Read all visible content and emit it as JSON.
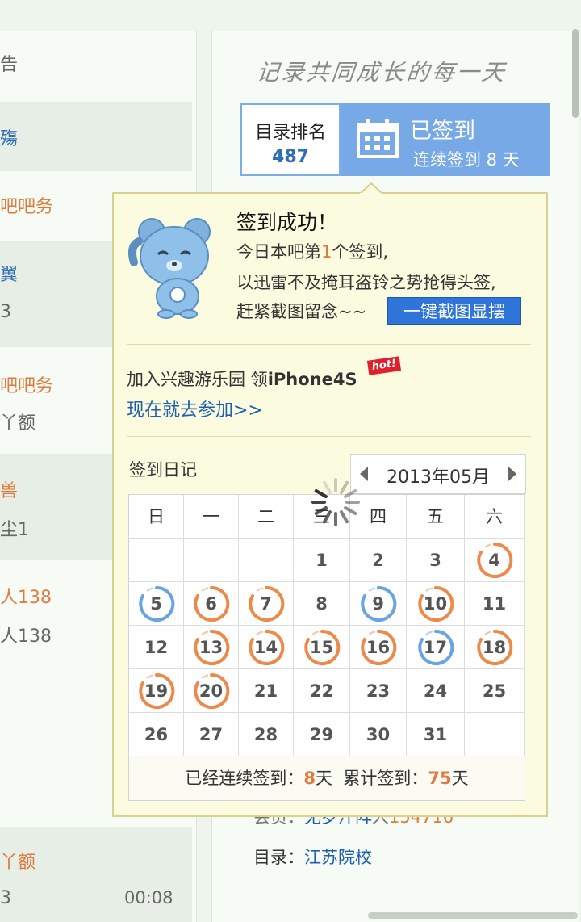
{
  "left_list": {
    "items": [
      {
        "text": "告",
        "color": "gray"
      },
      {
        "text": "殤",
        "color": "blue"
      },
      {
        "text": "吧吧务",
        "color": "orange"
      },
      {
        "text": "翼",
        "color": "blue"
      },
      {
        "text": "3",
        "color": "gray"
      },
      {
        "text": "吧吧务",
        "color": "orange"
      },
      {
        "text": "丫额",
        "color": "gray"
      },
      {
        "text": "兽",
        "color": "orange"
      },
      {
        "text": "尘1",
        "color": "gray"
      },
      {
        "text": "人138",
        "color": "orange"
      },
      {
        "text": "人138",
        "color": "gray"
      },
      {
        "text": "丫额",
        "color": "orange"
      },
      {
        "text": "3",
        "color": "gray"
      }
    ],
    "time": "00:08"
  },
  "header": {
    "slogan": "记录共同成长的每一天",
    "rank_label": "目录排名",
    "rank_value": "487",
    "signed_title": "已签到",
    "signed_sub": "连续签到 8 天"
  },
  "popup": {
    "title": "签到成功！",
    "line1_prefix": "今日本吧第",
    "line1_num": "1",
    "line1_suffix": "个签到,",
    "line2": "以迅雷不及掩耳盗铃之势抢得头签,",
    "line3": "赶紧截图留念~~",
    "share_button": "一键截图显摆",
    "join_text": "加入兴趣游乐园  领",
    "join_bold": "iPhone4S",
    "hot_badge": "hot!",
    "join_link": "现在就去参加>>",
    "diary_label": "签到日记",
    "month": "2013年05月",
    "weekdays": [
      "日",
      "一",
      "二",
      "三",
      "四",
      "五",
      "六"
    ],
    "days": [
      [
        null,
        null,
        null,
        1,
        2,
        3,
        4
      ],
      [
        5,
        6,
        7,
        8,
        9,
        10,
        11
      ],
      [
        12,
        13,
        14,
        15,
        16,
        17,
        18
      ],
      [
        19,
        20,
        21,
        22,
        23,
        24,
        25
      ],
      [
        26,
        27,
        28,
        29,
        30,
        31,
        null
      ]
    ],
    "signed_orange": [
      4,
      6,
      7,
      10,
      13,
      14,
      15,
      16,
      18,
      19,
      20
    ],
    "signed_blue": [
      5,
      9,
      17
    ],
    "footer_a": "已经连续签到：",
    "footer_a_num": "8",
    "footer_unit": "天",
    "footer_b": "累计签到：",
    "footer_b_num": "75"
  },
  "below": {
    "line1_a": "会员：",
    "line1_b": "无罗汗阵",
    "line1_c": "人",
    "line1_d": "154716",
    "dir_label": "目录：",
    "dir_link": "江苏院校"
  },
  "colors": {
    "accent_blue": "#76a9e6",
    "orange": "#e07a3e",
    "link": "#1f5fae",
    "popup_bg": "#fbfcdf"
  }
}
